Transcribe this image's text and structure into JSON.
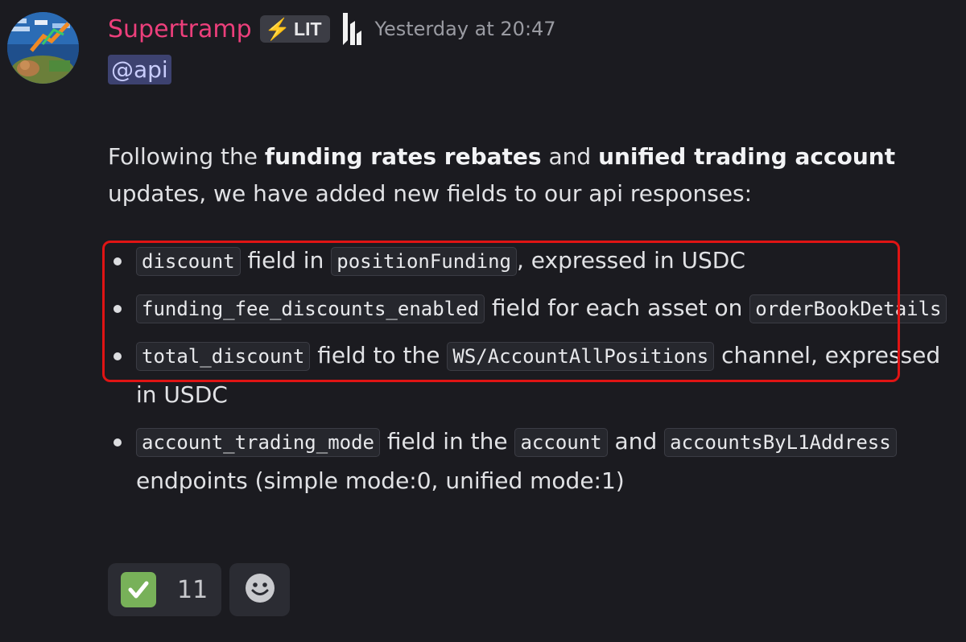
{
  "author": {
    "username": "Supertramp",
    "tag_label": "LIT",
    "tag_icon": "lightning-icon",
    "timestamp": "Yesterday at 20:47",
    "name_color": "#ec3f7b"
  },
  "message": {
    "mention": "@api",
    "intro": {
      "p1": "Following the ",
      "b1": "funding rates rebates",
      "p2": " and ",
      "b2": "unified trading account",
      "p3": " updates, we have added new fields to our api responses:"
    },
    "bullets": [
      {
        "code1": "discount",
        "t1": " field in ",
        "code2": "positionFunding",
        "t2": ", expressed in USDC"
      },
      {
        "code1": "funding_fee_discounts_enabled",
        "t1": " field for each asset on ",
        "code2": "orderBookDetails"
      },
      {
        "code1": "total_discount",
        "t1": " field to the ",
        "code2": "WS/AccountAllPositions",
        "t2": " channel, expressed in USDC"
      },
      {
        "code1": "account_trading_mode",
        "t1": " field in the ",
        "code2": "account",
        "t2": " and ",
        "code3": "accountsByL1Address",
        "t3": " endpoints (simple mode:0, unified mode:1)"
      }
    ]
  },
  "reactions": {
    "check": {
      "icon": "check-mark-icon",
      "count": "11"
    },
    "add": {
      "icon": "smiley-icon"
    }
  },
  "colors": {
    "background": "#1b1b20",
    "highlight_border": "#e01414",
    "mention_bg": "#3d4270",
    "check_green": "#78b159"
  }
}
